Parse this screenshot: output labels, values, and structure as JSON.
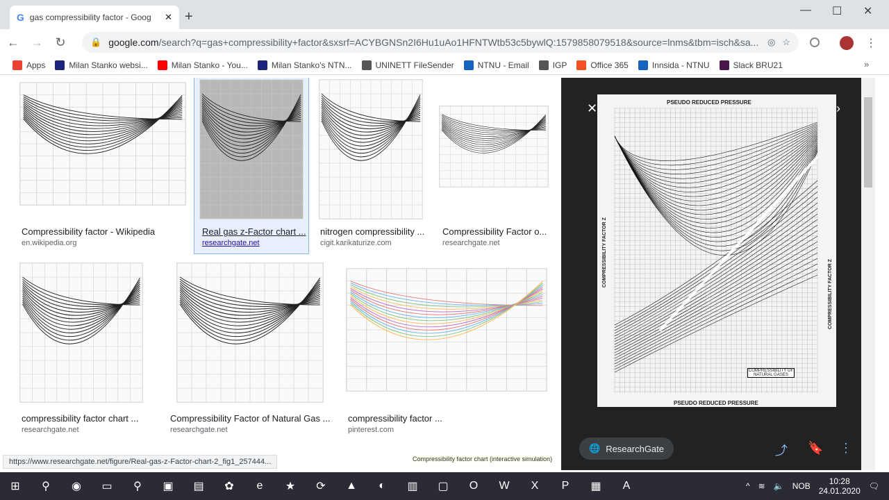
{
  "tab": {
    "title": "gas compressibility factor - Goog"
  },
  "address": {
    "domain": "google.com",
    "path": "/search?q=gas+compressibility+factor&sxsrf=ACYBGNSn2I6Hu1uAo1HFNTWtb53c5bywlQ:1579858079518&source=lnms&tbm=isch&sa..."
  },
  "bookmarks": [
    {
      "label": "Apps",
      "color": "#ea4335"
    },
    {
      "label": "Milan Stanko websi...",
      "color": "#1a237e"
    },
    {
      "label": "Milan Stanko - You...",
      "color": "#ff0000"
    },
    {
      "label": "Milan Stanko's NTN...",
      "color": "#1a237e"
    },
    {
      "label": "UNINETT FileSender",
      "color": "#555555"
    },
    {
      "label": "NTNU - Email",
      "color": "#1565c0"
    },
    {
      "label": "IGP",
      "color": "#555555"
    },
    {
      "label": "Office 365",
      "color": "#f25022"
    },
    {
      "label": "Innsida - NTNU",
      "color": "#1565c0"
    },
    {
      "label": "Slack BRU21",
      "color": "#4a154b"
    }
  ],
  "results": [
    {
      "caption": "Compressibility factor - Wikipedia",
      "source": "en.wikipedia.org"
    },
    {
      "caption": "Real gas z-Factor chart ...",
      "source": "researchgate.net"
    },
    {
      "caption": "nitrogen compressibility ...",
      "source": "cigit.karikaturize.com"
    },
    {
      "caption": "Compressibility Factor o...",
      "source": "researchgate.net"
    },
    {
      "caption": "compressibility factor chart ...",
      "source": "researchgate.net"
    },
    {
      "caption": "Compressibility Factor of Natural Gas ...",
      "source": "researchgate.net"
    },
    {
      "caption": "compressibility factor ...",
      "source": "pinterest.com"
    }
  ],
  "partial": "Compressibility factor chart (interactive simulation)",
  "preview": {
    "top": "PSEUDO REDUCED PRESSURE",
    "bottom": "PSEUDO REDUCED PRESSURE",
    "left": "COMPRESSIBILITY FACTOR Z",
    "right": "COMPRESSIBILITY FACTOR Z",
    "box": "COMPRESSIBILITY OF NATURAL GASES",
    "source": "ResearchGate"
  },
  "status_url": "https://www.researchgate.net/figure/Real-gas-z-Factor-chart-2_fig1_257444...",
  "clock": {
    "time": "10:28",
    "date": "24.01.2020",
    "lang": "NOB"
  }
}
